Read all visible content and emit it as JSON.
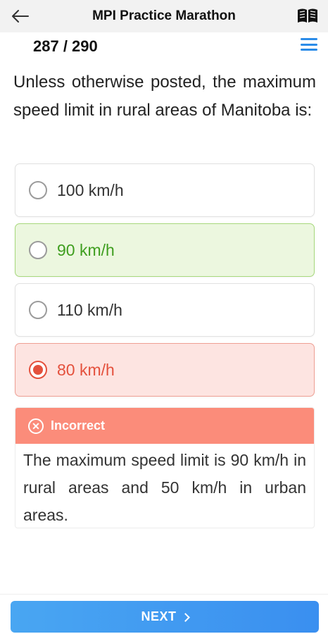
{
  "header": {
    "title": "MPI Practice Marathon",
    "back_icon": "arrow-left-icon",
    "book_icon": "open-book-icon"
  },
  "progress": {
    "counter": "287 / 290",
    "current": 287,
    "total": 290,
    "menu_icon": "hamburger-menu-icon"
  },
  "question": {
    "text": "Unless otherwise posted, the maximum speed limit in rural areas of Manitoba is:"
  },
  "options": [
    {
      "label": "100 km/h",
      "state": "neutral",
      "selected": false
    },
    {
      "label": "90 km/h",
      "state": "correct",
      "selected": false
    },
    {
      "label": "110 km/h",
      "state": "neutral",
      "selected": false
    },
    {
      "label": "80 km/h",
      "state": "incorrect",
      "selected": true
    }
  ],
  "feedback": {
    "status": "Incorrect",
    "icon": "x-circle-icon",
    "explanation": "The maximum speed limit is 90 km/h in rural areas and 50 km/h in urban areas."
  },
  "footer": {
    "next_label": "NEXT",
    "next_icon": "chevron-right-icon"
  },
  "colors": {
    "accent": "#3a8ff0",
    "correct": "#3f9e1f",
    "incorrect": "#e4513d",
    "feedback_header": "#fb8c7a"
  }
}
